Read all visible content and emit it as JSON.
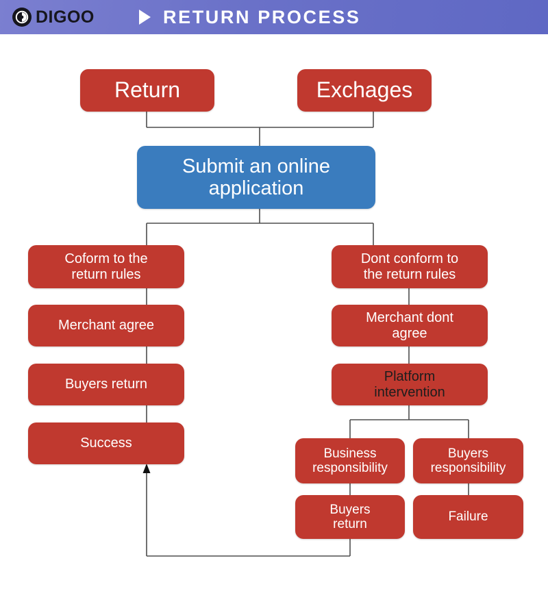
{
  "header": {
    "logo_text": "DIGOO",
    "logo_icon": "digoo-circle-icon",
    "play_icon": "play-triangle-icon",
    "title": "RETURN PROCESS",
    "gradient_from": "#7b7fd0",
    "gradient_to": "#5f68c4",
    "title_color": "#ffffff"
  },
  "palette": {
    "red": "#c0392f",
    "blue": "#3a7cbe",
    "connector": "#4d4d4d",
    "white_text": "#ffffff",
    "dark_text": "#1d1d1d"
  },
  "flow": {
    "title": "Return Process",
    "nodes": [
      {
        "id": "return",
        "label": "Return",
        "color": "red",
        "text": "white"
      },
      {
        "id": "exchanges",
        "label": "Exchages",
        "color": "red",
        "text": "white"
      },
      {
        "id": "submit-application",
        "label": "Submit an online\napplication",
        "color": "blue",
        "text": "white"
      },
      {
        "id": "conform-rules",
        "label": "Coform to the\nreturn rules",
        "color": "red",
        "text": "white"
      },
      {
        "id": "merchant-agree",
        "label": "Merchant agree",
        "color": "red",
        "text": "white"
      },
      {
        "id": "buyers-return-left",
        "label": "Buyers return",
        "color": "red",
        "text": "white"
      },
      {
        "id": "success",
        "label": "Success",
        "color": "red",
        "text": "white"
      },
      {
        "id": "dont-conform-rules",
        "label": "Dont conform to\nthe return rules",
        "color": "red",
        "text": "white"
      },
      {
        "id": "merchant-dont-agree",
        "label": "Merchant dont\nagree",
        "color": "red",
        "text": "white"
      },
      {
        "id": "platform-intervention",
        "label": "Platform\nintervention",
        "color": "red",
        "text": "dark"
      },
      {
        "id": "business-responsibility",
        "label": "Business\nresponsibility",
        "color": "red",
        "text": "white"
      },
      {
        "id": "buyers-responsibility",
        "label": "Buyers\nresponsibility",
        "color": "red",
        "text": "white"
      },
      {
        "id": "buyers-return-bottom",
        "label": "Buyers\nreturn",
        "color": "red",
        "text": "white"
      },
      {
        "id": "failure",
        "label": "Failure",
        "color": "red",
        "text": "white"
      }
    ],
    "edges": [
      {
        "from": "return",
        "to": "submit-application"
      },
      {
        "from": "exchanges",
        "to": "submit-application"
      },
      {
        "from": "submit-application",
        "to": "conform-rules"
      },
      {
        "from": "submit-application",
        "to": "dont-conform-rules"
      },
      {
        "from": "conform-rules",
        "to": "merchant-agree"
      },
      {
        "from": "merchant-agree",
        "to": "buyers-return-left"
      },
      {
        "from": "buyers-return-left",
        "to": "success"
      },
      {
        "from": "dont-conform-rules",
        "to": "merchant-dont-agree"
      },
      {
        "from": "merchant-dont-agree",
        "to": "platform-intervention"
      },
      {
        "from": "platform-intervention",
        "to": "business-responsibility"
      },
      {
        "from": "platform-intervention",
        "to": "buyers-responsibility"
      },
      {
        "from": "business-responsibility",
        "to": "buyers-return-bottom"
      },
      {
        "from": "buyers-responsibility",
        "to": "failure"
      },
      {
        "from": "buyers-return-bottom",
        "to": "success",
        "arrow": true
      }
    ]
  }
}
